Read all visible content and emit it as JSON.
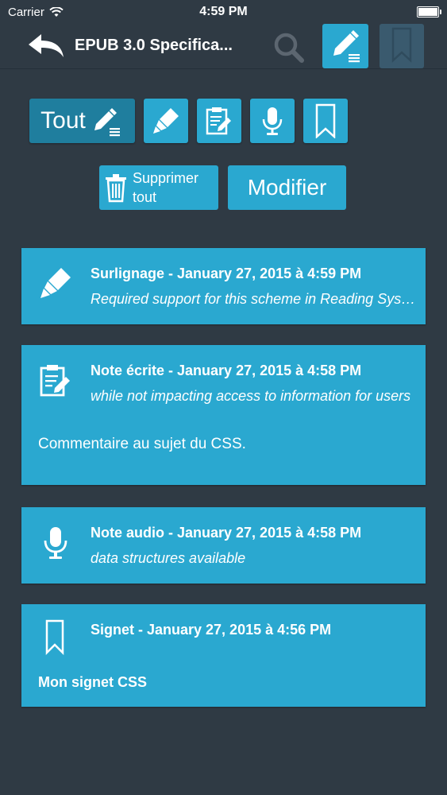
{
  "status_bar": {
    "carrier": "Carrier",
    "time": "4:59 PM"
  },
  "nav": {
    "title": "EPUB 3.0 Specifica..."
  },
  "filters": {
    "all_label": "Tout"
  },
  "actions": {
    "delete_all_line1": "Supprimer",
    "delete_all_line2": "tout",
    "modify_label": "Modifier"
  },
  "colors": {
    "background": "#2f3a44",
    "accent": "#2aa8d0",
    "accent_active": "#1f7e9e"
  },
  "annotations": [
    {
      "icon": "highlighter-icon",
      "title": "Surlignage - January 27, 2015 à 4:59 PM",
      "excerpt": "Required support for this scheme in Reading Systems",
      "comment": ""
    },
    {
      "icon": "clipboard-note-icon",
      "title": "Note écrite - January 27, 2015 à 4:58 PM",
      "excerpt": "while not impacting access to information for users",
      "comment": "Commentaire au sujet du CSS."
    },
    {
      "icon": "microphone-icon",
      "title": "Note audio - January 27, 2015 à 4:58 PM",
      "excerpt": "data structures available",
      "comment": ""
    },
    {
      "icon": "bookmark-icon",
      "title": "Signet - January 27, 2015 à 4:56 PM",
      "excerpt": "",
      "comment": "Mon signet CSS"
    }
  ]
}
